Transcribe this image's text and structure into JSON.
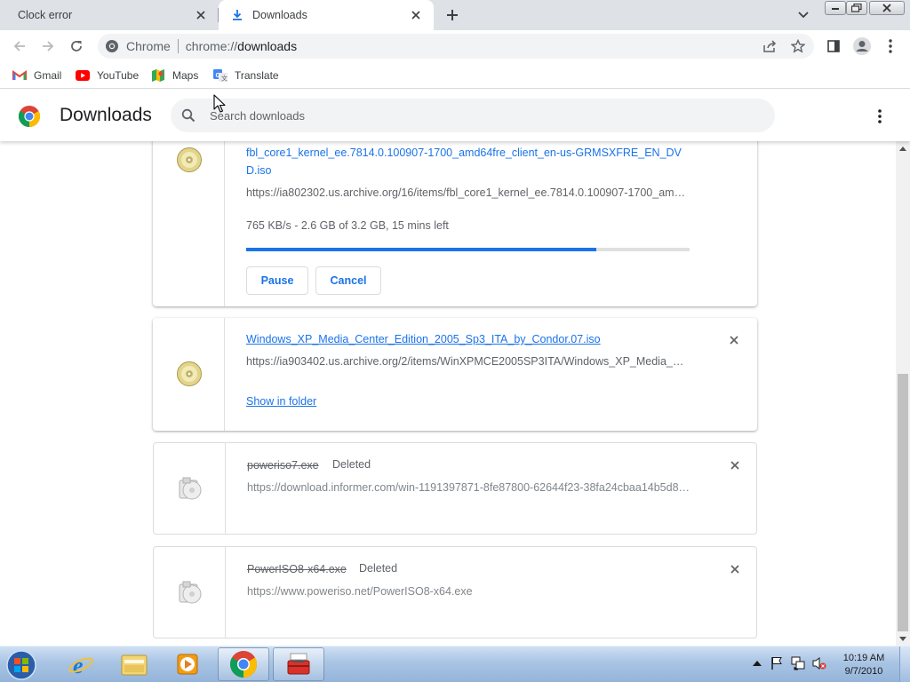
{
  "tabs": [
    {
      "title": "Clock error",
      "active": false
    },
    {
      "title": "Downloads",
      "active": true
    }
  ],
  "omnibox": {
    "scheme_label": "Chrome",
    "url_prefix": "chrome://",
    "url_host": "downloads"
  },
  "bookmarks": [
    {
      "label": "Gmail",
      "icon": "gmail-icon"
    },
    {
      "label": "YouTube",
      "icon": "youtube-icon"
    },
    {
      "label": "Maps",
      "icon": "maps-icon"
    },
    {
      "label": "Translate",
      "icon": "translate-icon"
    }
  ],
  "downloads_page": {
    "title": "Downloads",
    "search_placeholder": "Search downloads"
  },
  "downloads": [
    {
      "filename_line1": "fbl_core1_kernel_ee.7814.0.100907-1700_amd64fre_client_en-us-GRMSXFRE_EN_DV",
      "filename_line2": "D.iso",
      "url": "https://ia802302.us.archive.org/16/items/fbl_core1_kernel_ee.7814.0.100907-1700_amd64fre_client_en-us-GRMSXFRE_EN_DVD.iso",
      "status": "765 KB/s - 2.6 GB of 3.2 GB, 15 mins left",
      "progress_fraction": 0.79,
      "pause_label": "Pause",
      "cancel_label": "Cancel",
      "state": "in_progress"
    },
    {
      "filename": "Windows_XP_Media_Center_Edition_2005_Sp3_ITA_by_Condor.07.iso",
      "url": "https://ia903402.us.archive.org/2/items/WinXPMCE2005SP3ITA/Windows_XP_Media_Center_Edition_2005_Sp3_ITA_by_Condor.07.iso",
      "show_in_folder_label": "Show in folder",
      "state": "complete"
    },
    {
      "filename": "poweriso7.exe",
      "tag": "Deleted",
      "url": "https://download.informer.com/win-1191397871-8fe87800-62644f23-38fa24cbaa14b5d8/poweriso7.exe",
      "state": "deleted"
    },
    {
      "filename": "PowerISO8-x64.exe",
      "tag": "Deleted",
      "url": "https://www.poweriso.net/PowerISO8-x64.exe",
      "state": "deleted"
    }
  ],
  "taskbar": {
    "apps": [
      "internet-explorer-icon",
      "windows-explorer-icon",
      "media-player-icon",
      "chrome-icon",
      "toolbox-app-icon"
    ],
    "clock_time": "10:19 AM",
    "clock_date": "9/7/2010"
  },
  "colors": {
    "accent": "#1a73e8",
    "tabstrip": "#dee1e6",
    "omnibox": "#f1f3f4",
    "secondary_text": "#5f6368"
  }
}
